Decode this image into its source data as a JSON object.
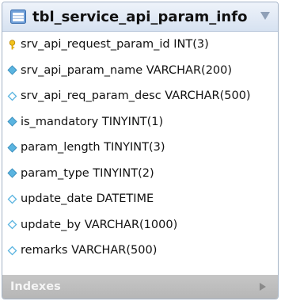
{
  "table": {
    "name": "tbl_service_api_param_info",
    "columns": [
      {
        "label": "srv_api_request_param_id INT(3)",
        "icon": "primary-key-icon"
      },
      {
        "label": "srv_api_param_name VARCHAR(200)",
        "icon": "not-null-column-icon"
      },
      {
        "label": "srv_api_req_param_desc VARCHAR(500)",
        "icon": "nullable-column-icon"
      },
      {
        "label": "is_mandatory TINYINT(1)",
        "icon": "not-null-column-icon"
      },
      {
        "label": "param_length TINYINT(3)",
        "icon": "not-null-column-icon"
      },
      {
        "label": "param_type TINYINT(2)",
        "icon": "not-null-column-icon"
      },
      {
        "label": "update_date DATETIME",
        "icon": "nullable-column-icon"
      },
      {
        "label": "update_by VARCHAR(1000)",
        "icon": "nullable-column-icon"
      },
      {
        "label": "remarks VARCHAR(500)",
        "icon": "nullable-column-icon"
      }
    ]
  },
  "indexes": {
    "label": "Indexes"
  },
  "colors": {
    "header_top": "#eef3fa",
    "header_bottom": "#d7e2f1",
    "key_yellow": "#f2c21b",
    "column_blue": "#5ab4e0",
    "footer_gray": "#bdbdbd"
  }
}
